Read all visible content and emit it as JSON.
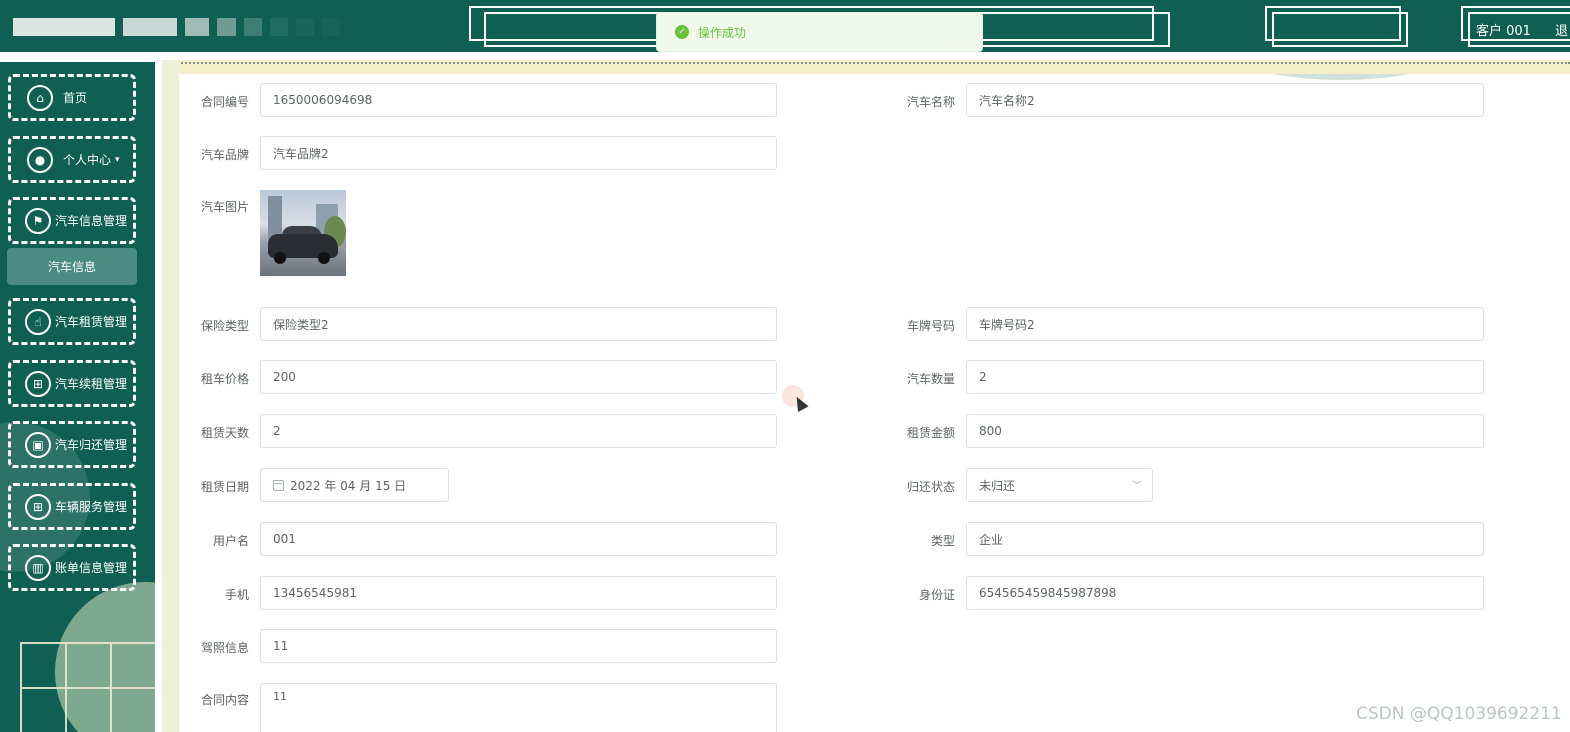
{
  "colors": {
    "primary": "#0f5f55",
    "success": "#67c23a",
    "submenu_bg": "#4a8c84"
  },
  "header": {
    "user_name": "客户 001",
    "logout_label": "退"
  },
  "toast": {
    "icon": "check-circle-icon",
    "message": "操作成功"
  },
  "sidebar": {
    "items": [
      {
        "label": "首页",
        "icon": "home-icon"
      },
      {
        "label": "个人中心",
        "icon": "user-icon"
      },
      {
        "label": "汽车信息管理",
        "icon": "flag-icon"
      },
      {
        "label": "汽车租赁管理",
        "icon": "thumb-icon"
      },
      {
        "label": "汽车续租管理",
        "icon": "grid-icon"
      },
      {
        "label": "汽车归还管理",
        "icon": "clipboard-icon"
      },
      {
        "label": "车辆服务管理",
        "icon": "grid-icon"
      },
      {
        "label": "账单信息管理",
        "icon": "chart-icon"
      }
    ],
    "submenu_label": "汽车信息"
  },
  "form": {
    "contract_no": {
      "label": "合同编号",
      "value": "1650006094698"
    },
    "car_name": {
      "label": "汽车名称",
      "value": "汽车名称2"
    },
    "car_brand": {
      "label": "汽车品牌",
      "value": "汽车品牌2"
    },
    "car_image": {
      "label": "汽车图片"
    },
    "insurance_type": {
      "label": "保险类型",
      "value": "保险类型2"
    },
    "plate_no": {
      "label": "车牌号码",
      "value": "车牌号码2"
    },
    "rent_price": {
      "label": "租车价格",
      "value": "200"
    },
    "car_count": {
      "label": "汽车数量",
      "value": "2"
    },
    "rent_days": {
      "label": "租赁天数",
      "value": "2"
    },
    "rent_amount": {
      "label": "租赁金额",
      "value": "800"
    },
    "rent_date": {
      "label": "租赁日期",
      "value": "2022 年 04 月 15 日"
    },
    "return_status": {
      "label": "归还状态",
      "value": "未归还"
    },
    "username": {
      "label": "用户名",
      "value": "001"
    },
    "type": {
      "label": "类型",
      "value": "企业"
    },
    "phone": {
      "label": "手机",
      "value": "13456545981"
    },
    "id_card": {
      "label": "身份证",
      "value": "654565459845987898"
    },
    "license_info": {
      "label": "驾照信息",
      "value": "11"
    },
    "contract_content": {
      "label": "合同内容",
      "value": "11"
    }
  },
  "watermark": "CSDN @QQ1039692211"
}
